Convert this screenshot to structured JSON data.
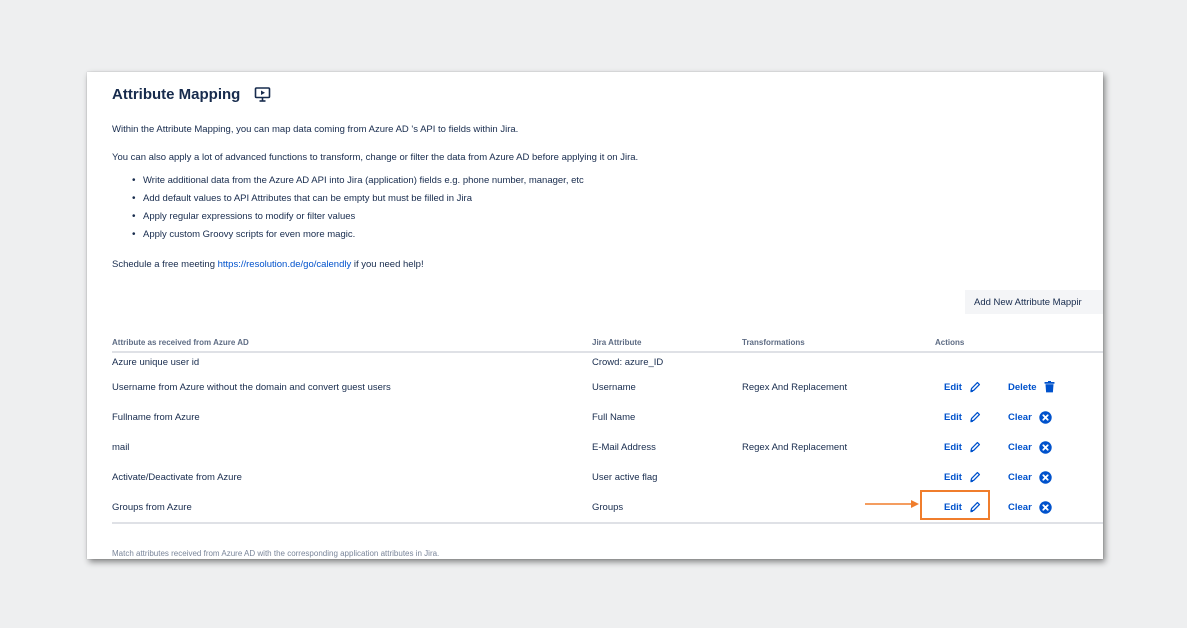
{
  "title": "Attribute Mapping",
  "intro1": "Within the Attribute Mapping, you can map data coming from Azure AD 's API to fields within Jira.",
  "intro2": "You can also apply a lot of advanced functions to transform, change or filter the data from Azure AD before applying it on Jira.",
  "bullets": [
    "Write additional data from the Azure AD API into Jira (application) fields e.g. phone number, manager, etc",
    "Add default values to API Attributes that can be empty but must be filled in Jira",
    "Apply regular expressions to modify or filter values",
    "Apply custom Groovy scripts for even more magic."
  ],
  "schedule": {
    "prefix": "Schedule a free meeting ",
    "link": "https://resolution.de/go/calendly",
    "suffix": " if you need help!"
  },
  "add_button": "Add New Attribute Mappir",
  "columns": {
    "source": "Attribute as received from Azure AD",
    "jira": "Jira Attribute",
    "transform": "Transformations",
    "actions": "Actions"
  },
  "rows": [
    {
      "source": "Azure unique user id",
      "jira": "Crowd: azure_ID",
      "transform": "",
      "edit": "",
      "second": ""
    },
    {
      "source": "Username from Azure without the domain and convert guest users",
      "jira": "Username",
      "transform": "Regex And Replacement",
      "edit": "Edit",
      "second": "Delete"
    },
    {
      "source": "Fullname from Azure",
      "jira": "Full Name",
      "transform": "",
      "edit": "Edit",
      "second": "Clear"
    },
    {
      "source": "mail",
      "jira": "E-Mail Address",
      "transform": "Regex And Replacement",
      "edit": "Edit",
      "second": "Clear"
    },
    {
      "source": "Activate/Deactivate from Azure",
      "jira": "User active flag",
      "transform": "",
      "edit": "Edit",
      "second": "Clear"
    },
    {
      "source": "Groups from Azure",
      "jira": "Groups",
      "transform": "",
      "edit": "Edit",
      "second": "Clear"
    }
  ],
  "footer": "Match attributes received from Azure AD with the corresponding application attributes in Jira.",
  "colors": {
    "link": "#0052cc",
    "highlight": "#f07d2c",
    "text": "#172b4d"
  }
}
